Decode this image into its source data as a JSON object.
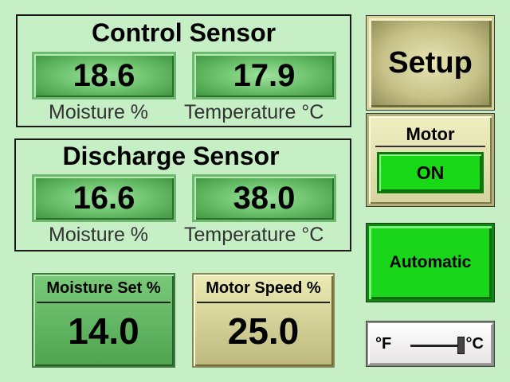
{
  "control_sensor": {
    "title": "Control Sensor",
    "moisture_value": "18.6",
    "moisture_label": "Moisture %",
    "temperature_value": "17.9",
    "temperature_label": "Temperature °C"
  },
  "discharge_sensor": {
    "title": "Discharge Sensor",
    "moisture_value": "16.6",
    "moisture_label": "Moisture %",
    "temperature_value": "38.0",
    "temperature_label": "Temperature °C"
  },
  "moisture_set": {
    "label": "Moisture Set %",
    "value": "14.0"
  },
  "motor_speed": {
    "label": "Motor Speed %",
    "value": "25.0"
  },
  "setup_button": {
    "label": "Setup"
  },
  "motor": {
    "title": "Motor",
    "state": "ON"
  },
  "automatic_button": {
    "label": "Automatic"
  },
  "unit_toggle": {
    "left_label": "°F",
    "right_label": "°C",
    "selected": "°C"
  },
  "colors": {
    "background": "#c6efc6",
    "value_green": "#6fc46f",
    "active_green": "#1ad61a",
    "khaki": "#c7c289"
  }
}
